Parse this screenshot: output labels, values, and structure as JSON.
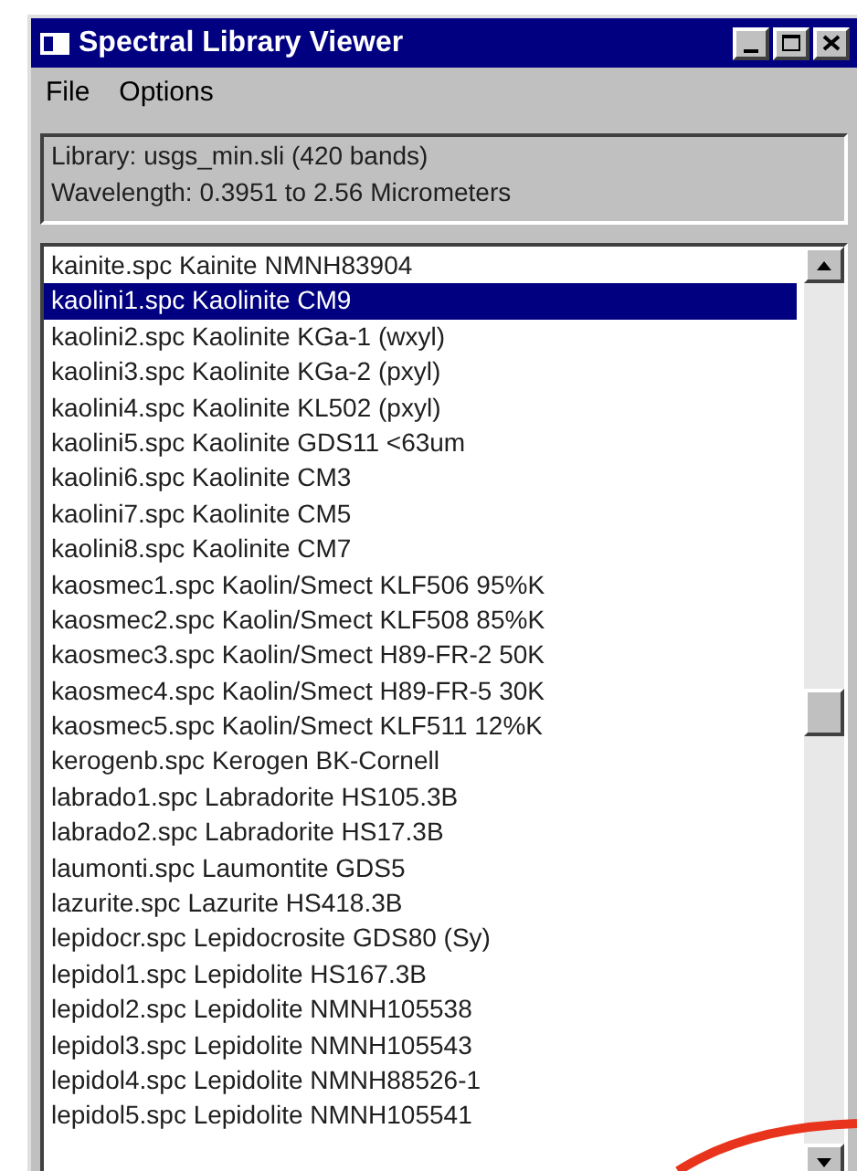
{
  "window": {
    "title": "Spectral Library Viewer"
  },
  "menu": [
    "File",
    "Options"
  ],
  "info": [
    "Library: usgs_min.sli (420 bands)",
    "Wavelength: 0.3951 to 2.56 Micrometers"
  ],
  "list": [
    {
      "label": "kainite.spc Kainite NMNH83904",
      "selected": false
    },
    {
      "label": "kaolini1.spc Kaolinite CM9",
      "selected": true
    },
    {
      "label": "kaolini2.spc Kaolinite KGa-1 (wxyl)",
      "selected": false
    },
    {
      "label": "kaolini3.spc Kaolinite KGa-2 (pxyl)",
      "selected": false
    },
    {
      "label": "kaolini4.spc Kaolinite KL502 (pxyl)",
      "selected": false
    },
    {
      "label": "kaolini5.spc Kaolinite GDS11 <63um",
      "selected": false
    },
    {
      "label": "kaolini6.spc Kaolinite CM3",
      "selected": false
    },
    {
      "label": "kaolini7.spc Kaolinite CM5",
      "selected": false
    },
    {
      "label": "kaolini8.spc Kaolinite CM7",
      "selected": false
    },
    {
      "label": "kaosmec1.spc Kaolin/Smect KLF506 95%K",
      "selected": false
    },
    {
      "label": "kaosmec2.spc Kaolin/Smect KLF508 85%K",
      "selected": false
    },
    {
      "label": "kaosmec3.spc Kaolin/Smect H89-FR-2 50K",
      "selected": false
    },
    {
      "label": "kaosmec4.spc Kaolin/Smect H89-FR-5 30K",
      "selected": false
    },
    {
      "label": "kaosmec5.spc Kaolin/Smect KLF511 12%K",
      "selected": false
    },
    {
      "label": "kerogenb.spc Kerogen BK-Cornell",
      "selected": false
    },
    {
      "label": "labrado1.spc Labradorite HS105.3B",
      "selected": false
    },
    {
      "label": "labrado2.spc Labradorite HS17.3B",
      "selected": false
    },
    {
      "label": "laumonti.spc Laumontite GDS5",
      "selected": false
    },
    {
      "label": "lazurite.spc Lazurite HS418.3B",
      "selected": false
    },
    {
      "label": "lepidocr.spc Lepidocrosite GDS80 (Sy)",
      "selected": false
    },
    {
      "label": "lepidol1.spc Lepidolite HS167.3B",
      "selected": false
    },
    {
      "label": "lepidol2.spc Lepidolite NMNH105538",
      "selected": false
    },
    {
      "label": "lepidol3.spc Lepidolite NMNH105543",
      "selected": false
    },
    {
      "label": "lepidol4.spc Lepidolite NMNH88526-1",
      "selected": false
    },
    {
      "label": "lepidol5.spc Lepidolite NMNH105541",
      "selected": false
    }
  ]
}
